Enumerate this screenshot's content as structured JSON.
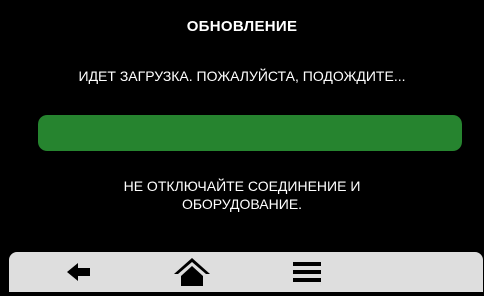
{
  "screen": {
    "title": "ОБНОВЛЕНИЕ",
    "status_text": "ИДЕТ ЗАГРУЗКА. ПОЖАЛУЙСТА, ПОДОЖДИТЕ...",
    "progress_percent": 100,
    "warning_line1": "НЕ ОТКЛЮЧАЙТЕ СОЕДИНЕНИЕ И",
    "warning_line2": "ОБОРУДОВАНИЕ."
  },
  "colors": {
    "background": "#000000",
    "progress_fill": "#26842f",
    "toolbar": "#dedede",
    "icon": "#000000"
  },
  "toolbar": {
    "buttons": [
      {
        "icon": "back-arrow-icon"
      },
      {
        "icon": "home-icon"
      },
      {
        "icon": "menu-icon"
      }
    ]
  }
}
